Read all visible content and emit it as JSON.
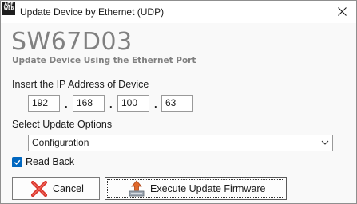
{
  "window": {
    "title": "Update Device by Ethernet (UDP)",
    "app_icon_lines": [
      "ADF",
      "WEB"
    ]
  },
  "header": {
    "product_name": "SW67D03",
    "subtitle": "Update Device Using the Ethernet Port"
  },
  "ip_section": {
    "label": "Insert the IP Address of Device",
    "octets": [
      "192",
      "168",
      "100",
      "63"
    ],
    "separator": "."
  },
  "update_options": {
    "label": "Select Update Options",
    "selected": "Configuration"
  },
  "read_back": {
    "label": "Read Back",
    "checked": true
  },
  "buttons": {
    "cancel_label": "Cancel",
    "execute_label": "Execute Update Firmware"
  },
  "colors": {
    "accent": "#0067c0",
    "muted_text": "#808080",
    "cancel_icon": "#d9342b",
    "upload_arrow": "#e0682a"
  },
  "icons": {
    "app": "app-logo-icon",
    "close": "close-icon",
    "chevron": "chevron-down-icon",
    "check": "checkmark-icon",
    "cancel": "red-x-icon",
    "execute": "upload-arrow-icon"
  }
}
